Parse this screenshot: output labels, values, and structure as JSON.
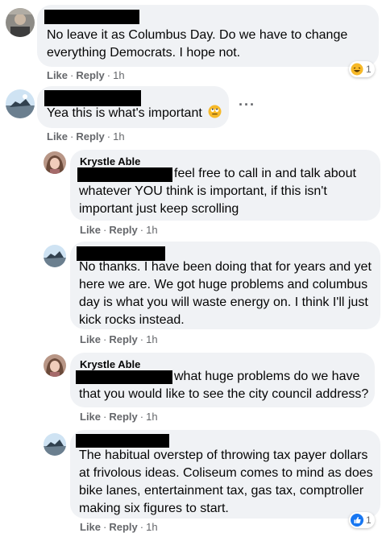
{
  "comments": [
    {
      "author": "",
      "text": "No leave it as Columbus Day. Do we have to change everything Democrats. I hope not.",
      "line1": "No leave it as Columbus Day. Do we have to change",
      "line2": "everything Democrats. I hope not.",
      "like": "Like",
      "reply": "Reply",
      "time": "1h",
      "reaction": {
        "icon": "haha-emoji",
        "count": "1"
      }
    },
    {
      "author": "",
      "text": "Yea this is what's important",
      "like": "Like",
      "reply": "Reply",
      "time": "1h",
      "emoji": "rolling-eyes-emoji",
      "more": "···"
    },
    {
      "author": "Krystle Able",
      "line1_suffix": "feel free to call in and talk about",
      "line2": "whatever YOU think is important, if this isn't",
      "line3": "important just keep scrolling",
      "like": "Like",
      "reply": "Reply",
      "time": "1h"
    },
    {
      "author": "",
      "line1": "No thanks. I have been doing that for years and yet",
      "line2": "here we are. We got huge problems and columbus",
      "line3": "day is what you will waste energy on. I think I'll just",
      "line4": "kick rocks instead.",
      "like": "Like",
      "reply": "Reply",
      "time": "1h"
    },
    {
      "author": "Krystle Able",
      "line1_suffix": "what huge problems do we have",
      "line2": "that you would like to see the city council address?",
      "like": "Like",
      "reply": "Reply",
      "time": "1h"
    },
    {
      "author": "",
      "line1": "The habitual overstep of throwing tax payer dollars",
      "line2": "at frivolous ideas. Coliseum comes to mind as does",
      "line3": "bike lanes, entertainment tax, gas tax, comptroller",
      "line4": "making six figures to start.",
      "like": "Like",
      "reply": "Reply",
      "time": "1h",
      "reaction": {
        "icon": "like-icon",
        "count": "1"
      }
    }
  ],
  "separator": "·",
  "colors": {
    "bubble": "#f0f2f5",
    "meta": "#65676b",
    "like_blue": "#1877f2",
    "haha_yellow": "#f7b928"
  }
}
